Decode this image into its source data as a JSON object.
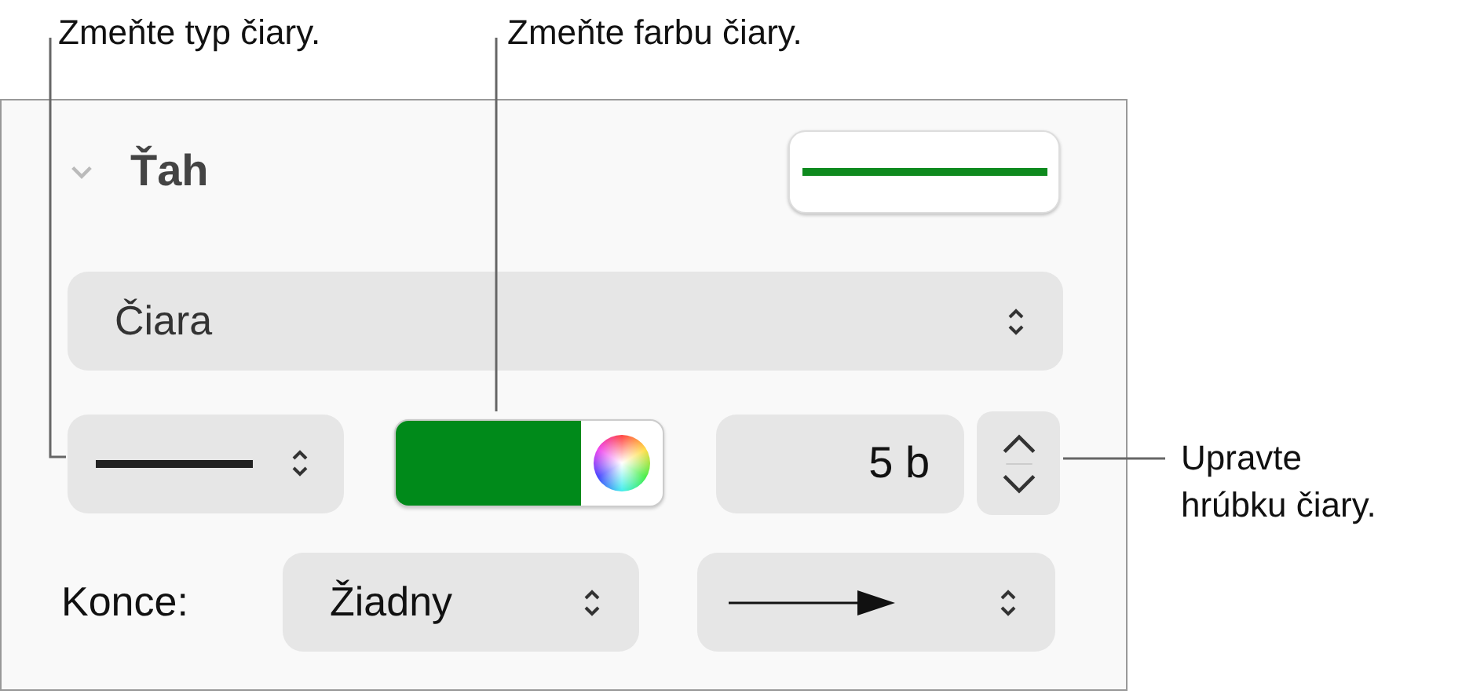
{
  "callouts": [
    {
      "text": "Zmeňte typ čiary."
    },
    {
      "text": "Zmeňte farbu čiary."
    },
    {
      "text": "Upravte hrúbku čiary."
    }
  ],
  "stroke_section": {
    "title": "Ťah",
    "expanded": true
  },
  "line_popup": {
    "value": "Čiara"
  },
  "width_field": {
    "value": "5 b"
  },
  "endings": {
    "label": "Konce:",
    "start_value": "Žiadny"
  }
}
